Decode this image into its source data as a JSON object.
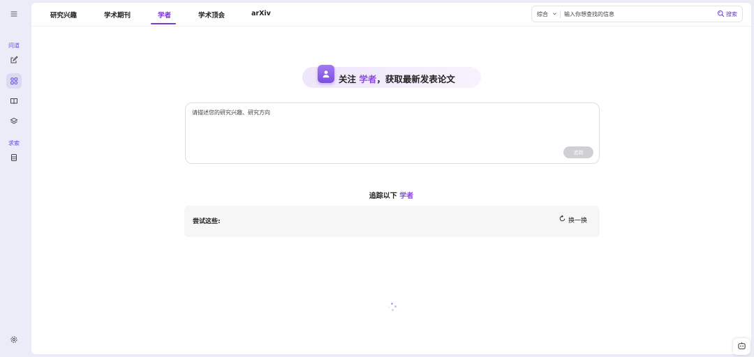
{
  "sidebar": {
    "section1_label": "问道",
    "section2_label": "求索",
    "items": [
      {
        "icon": "menu-icon"
      },
      {
        "icon": "edit-icon"
      },
      {
        "icon": "apps-icon"
      },
      {
        "icon": "book-icon"
      },
      {
        "icon": "layers-icon"
      },
      {
        "icon": "database-icon"
      },
      {
        "icon": "gear-icon"
      }
    ]
  },
  "nav": {
    "tabs": [
      {
        "label": "研究兴趣"
      },
      {
        "label": "学术期刊"
      },
      {
        "label": "学者"
      },
      {
        "label": "学术顶会"
      },
      {
        "label": "arXiv"
      }
    ],
    "active_tab": "学者"
  },
  "search": {
    "category": "综合",
    "placeholder": "输入你想查找的信息",
    "button_label": "搜索"
  },
  "hero": {
    "prefix": "关注 ",
    "highlight": "学者",
    "suffix": "，获取最新发表论文"
  },
  "interest_input": {
    "placeholder": "请描述您的研究兴趣、研究方向",
    "submit_label": "追踪"
  },
  "follow": {
    "prefix": "追踪以下 ",
    "highlight": "学者"
  },
  "suggestions": {
    "label": "尝试这些:",
    "refresh_label": "换一换"
  },
  "colors": {
    "accent": "#7a3bd0",
    "sidebar_bg": "#ecebf8"
  }
}
